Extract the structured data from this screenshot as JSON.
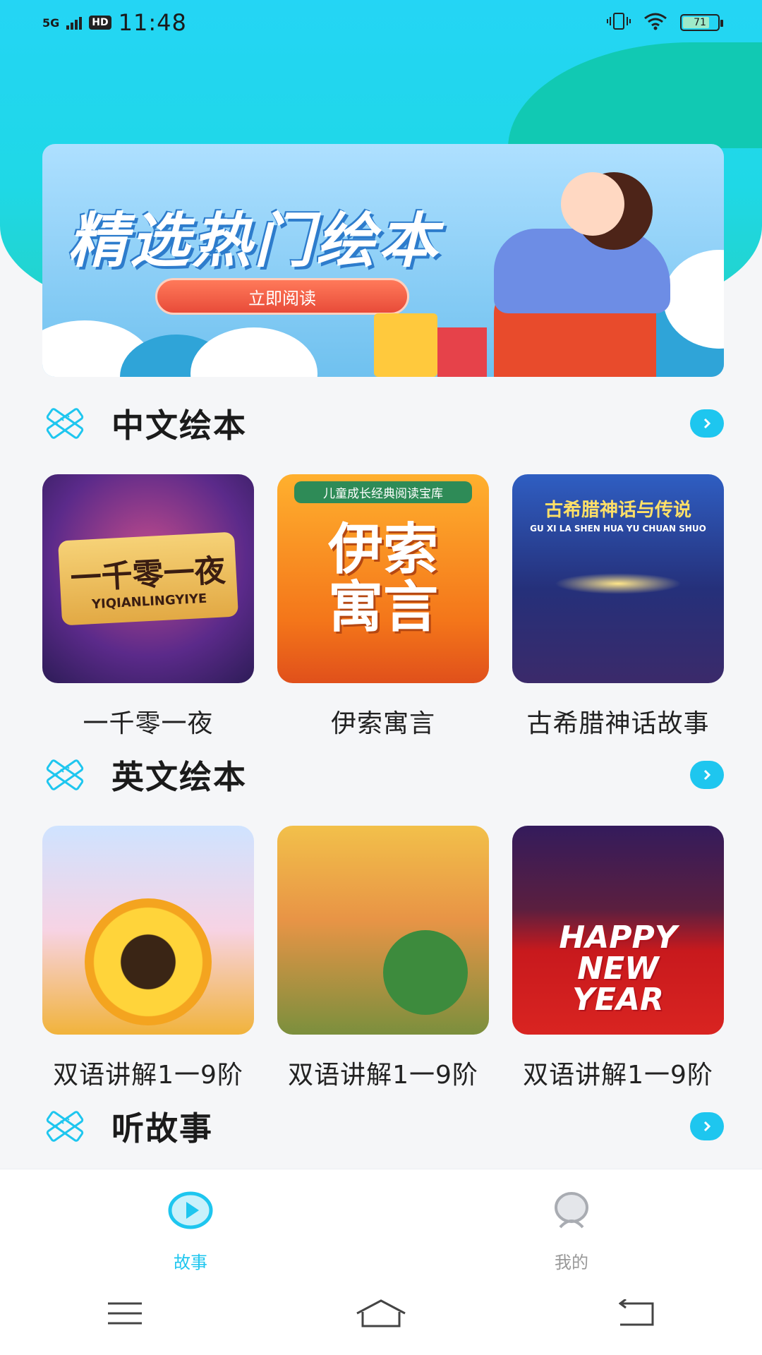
{
  "status_bar": {
    "network": "5G",
    "hd": "HD",
    "time": "11:48",
    "battery": "71"
  },
  "banner": {
    "title": "精选热门绘本",
    "button": "立即阅读"
  },
  "sections": [
    {
      "title": "中文绘本",
      "books": [
        {
          "label": "一千零一夜",
          "cover_title": "一千零一夜",
          "cover_sub": "YIQIANLINGYIYE"
        },
        {
          "label": "伊索寓言",
          "cover_title": "伊索寓言",
          "cover_top": "儿童成长经典阅读宝库"
        },
        {
          "label": "古希腊神话故事",
          "cover_title": "古希腊神话与传说",
          "cover_sub": "GU XI LA SHEN HUA YU CHUAN SHUO"
        }
      ]
    },
    {
      "title": "英文绘本",
      "books": [
        {
          "label": "双语讲解1一9阶"
        },
        {
          "label": "双语讲解1一9阶"
        },
        {
          "label": "双语讲解1一9阶",
          "cover_title": "HAPPY NEW YEAR"
        }
      ]
    },
    {
      "title": "听故事"
    }
  ],
  "bottom_nav": [
    {
      "label": "故事",
      "icon": "play-circle-icon",
      "active": true
    },
    {
      "label": "我的",
      "icon": "user-icon",
      "active": false
    }
  ],
  "system_nav": [
    "menu-icon",
    "home-icon",
    "back-icon"
  ],
  "colors": {
    "accent": "#1ec6ef",
    "header": "#24d5f5"
  }
}
